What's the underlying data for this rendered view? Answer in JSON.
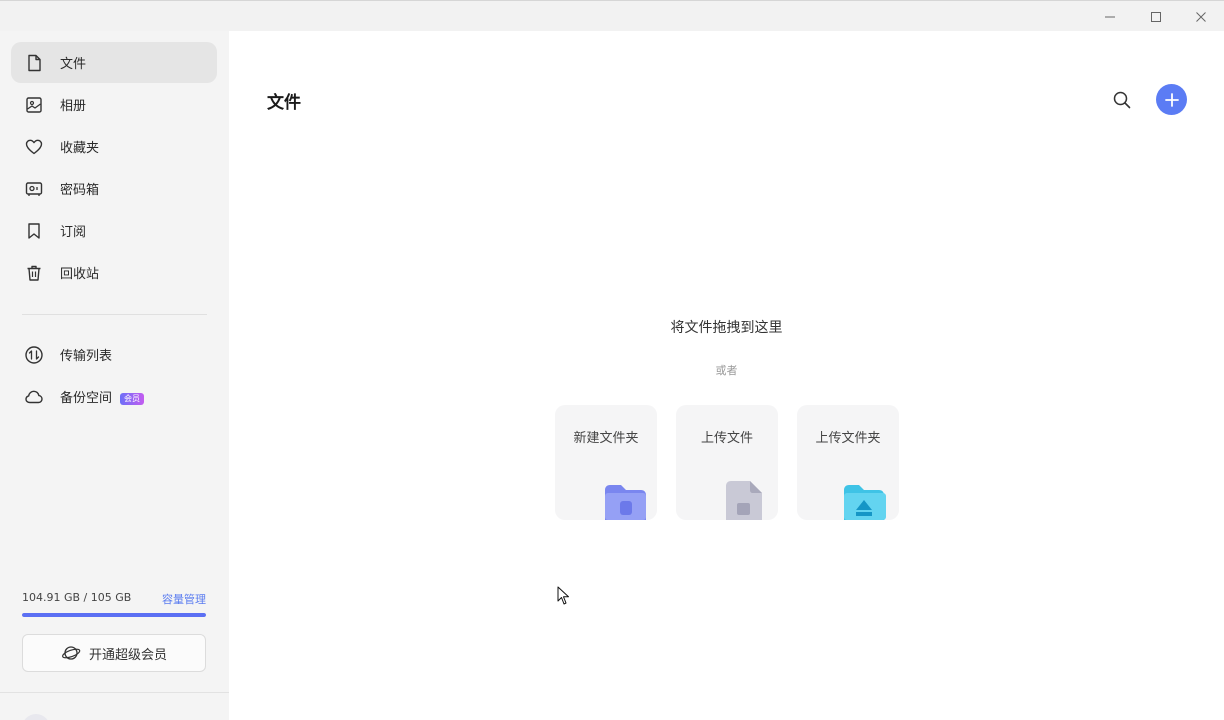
{
  "window": {
    "controls": [
      "minimize-icon",
      "maximize-icon",
      "close-icon"
    ]
  },
  "sidebar": {
    "items": [
      {
        "label": "文件",
        "icon": "file-icon",
        "active": true
      },
      {
        "label": "相册",
        "icon": "photo-icon",
        "active": false
      },
      {
        "label": "收藏夹",
        "icon": "heart-icon",
        "active": false
      },
      {
        "label": "密码箱",
        "icon": "safe-icon",
        "active": false
      },
      {
        "label": "订阅",
        "icon": "bookmark-icon",
        "active": false
      },
      {
        "label": "回收站",
        "icon": "trash-icon",
        "active": false
      }
    ],
    "secondary_items": [
      {
        "label": "传输列表",
        "icon": "transfer-icon"
      },
      {
        "label": "备份空间",
        "icon": "cloud-icon",
        "badge": "会员"
      }
    ],
    "storage": {
      "used_text": "104.91 GB / 105 GB",
      "manage_label": "容量管理",
      "used_fraction": 0.999
    },
    "vip_button_label": "开通超级会员"
  },
  "main": {
    "title": "文件",
    "drop_hint": "将文件拖拽到这里",
    "or_text": "或者",
    "cards": [
      {
        "label": "新建文件夹",
        "icon": "new-folder-icon"
      },
      {
        "label": "上传文件",
        "icon": "upload-file-icon"
      },
      {
        "label": "上传文件夹",
        "icon": "upload-folder-icon"
      }
    ]
  },
  "colors": {
    "accent": "#5b7cf4",
    "sidebar_bg": "#f4f4f4",
    "active_item_bg": "#e5e5e5",
    "link": "#5a7cf0"
  }
}
